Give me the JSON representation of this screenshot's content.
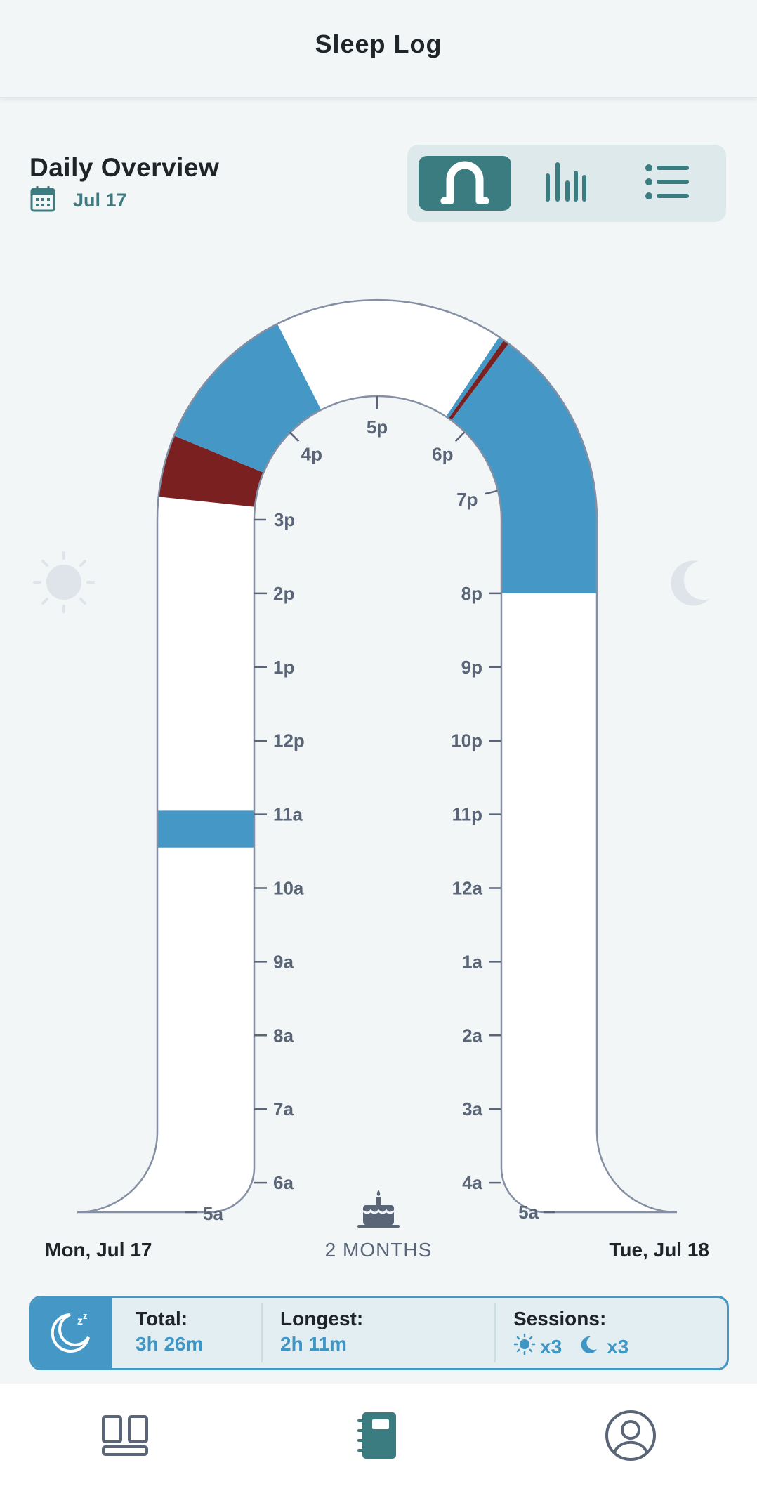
{
  "header": {
    "title": "Sleep Log"
  },
  "overview": {
    "title": "Daily Overview",
    "date": "Jul 17",
    "calendar_icon": "calendar-icon"
  },
  "view_toggle": [
    {
      "name": "arch-view",
      "icon": "arch-icon",
      "active": true
    },
    {
      "name": "bar-view",
      "icon": "bar-chart-icon",
      "active": false
    },
    {
      "name": "list-view",
      "icon": "list-icon",
      "active": false
    }
  ],
  "chart_data": {
    "type": "timeline",
    "left_ticks": [
      "6a",
      "7a",
      "8a",
      "9a",
      "10a",
      "11a",
      "12p",
      "1p",
      "2p",
      "3p",
      "4p"
    ],
    "top_ticks": [
      "4p",
      "5p",
      "6p"
    ],
    "right_ticks": [
      "7p",
      "8p",
      "9p",
      "10p",
      "11p",
      "12a",
      "1a",
      "2a",
      "3a",
      "4a"
    ],
    "end_labels": {
      "start": "5a",
      "end": "5a"
    },
    "sessions": [
      {
        "start": "10:33a",
        "end": "11:03a",
        "kind": "sleep",
        "color": "#4598c6"
      },
      {
        "start": "3:08p",
        "end": "3:30p",
        "kind": "wake",
        "color": "#7a2020"
      },
      {
        "start": "3:30p",
        "end": "4:24p",
        "kind": "sleep",
        "color": "#4598c6"
      },
      {
        "start": "5:45p",
        "end": "5:47p",
        "kind": "sleep",
        "color": "#4598c6"
      },
      {
        "start": "5:47p",
        "end": "5:49p",
        "kind": "wake",
        "color": "#7a2020"
      },
      {
        "start": "5:49p",
        "end": "8:00p",
        "kind": "sleep",
        "color": "#4598c6"
      }
    ],
    "colors": {
      "sleep": "#4598c6",
      "wake": "#7a2020",
      "track": "#ffffff",
      "outline": "#858fa3"
    },
    "side_icons": {
      "day": "sun-icon",
      "night": "moon-icon"
    }
  },
  "footer": {
    "left_date": "Mon, Jul 17",
    "age": "2 MONTHS",
    "right_date": "Tue, Jul 18",
    "age_icon": "cake-icon"
  },
  "summary": {
    "icon": "sleep-moon-icon",
    "total_label": "Total:",
    "total_value": "3h 26m",
    "longest_label": "Longest:",
    "longest_value": "2h 11m",
    "sessions_label": "Sessions:",
    "day_sessions": "x3",
    "night_sessions": "x3"
  },
  "nav": [
    {
      "name": "dashboard",
      "icon": "dashboard-icon",
      "active": false
    },
    {
      "name": "log",
      "icon": "log-book-icon",
      "active": true
    },
    {
      "name": "profile",
      "icon": "profile-icon",
      "active": false
    }
  ]
}
